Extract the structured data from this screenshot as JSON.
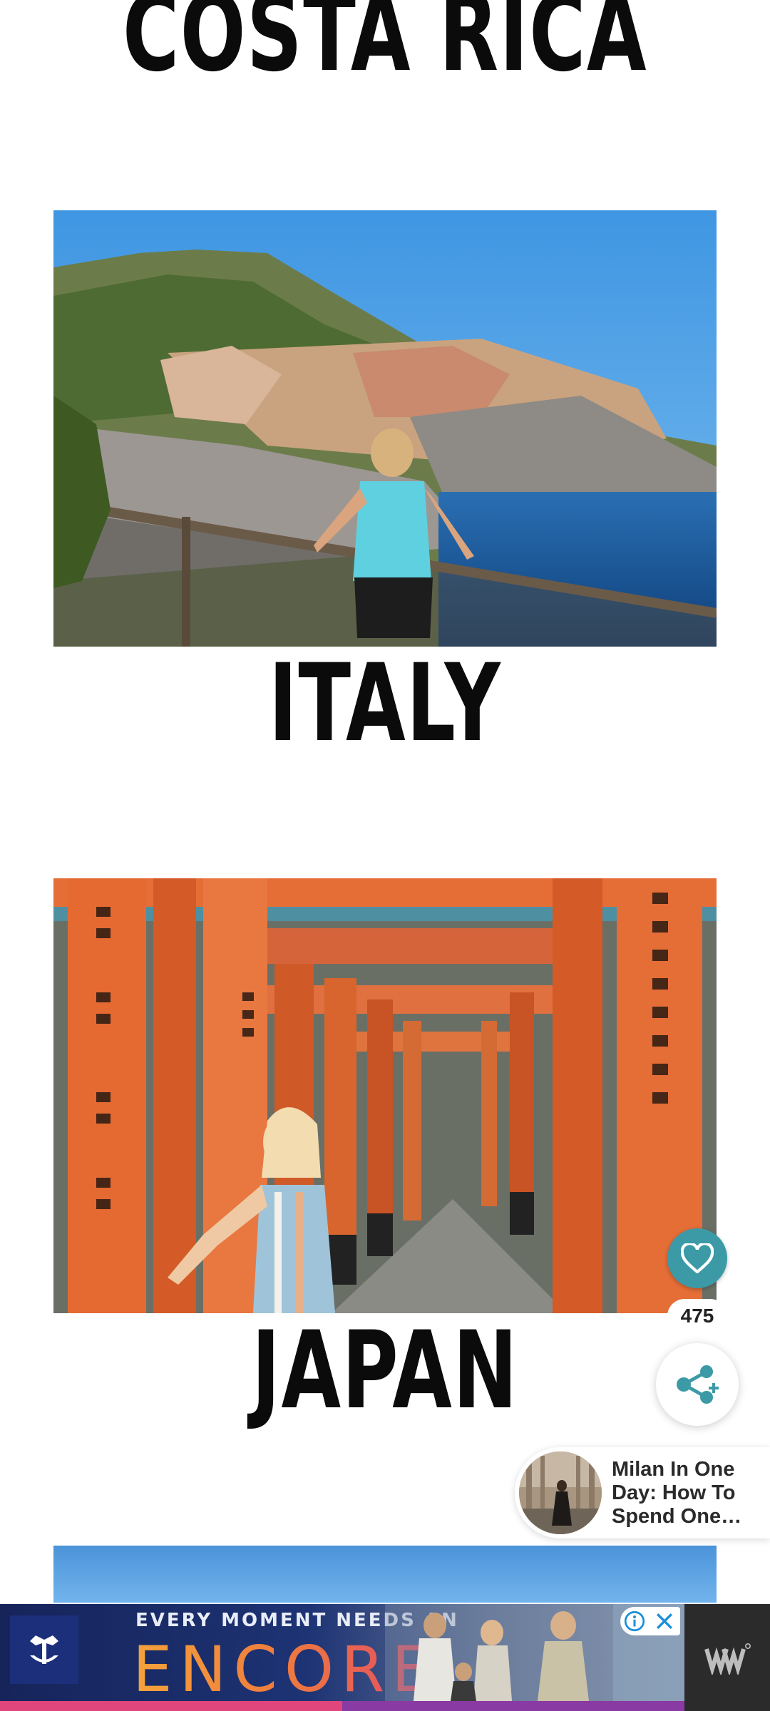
{
  "titles": {
    "costa_rica": "COSTA RICA",
    "italy": "ITALY",
    "japan": "JAPAN"
  },
  "photos": {
    "italy": "italy-cliff-village-photo",
    "japan": "japan-torii-gates-photo",
    "next": "sky-photo-partial"
  },
  "share_widget": {
    "like_icon": "heart-icon",
    "share_count": "475",
    "share_icon": "share-icon",
    "accent_color": "#3c9aa6"
  },
  "related_article": {
    "title": "Milan In One Day: How To Spend One…"
  },
  "ad": {
    "tagline": "EVERY MOMENT NEEDS AN",
    "headline": "ENCORE",
    "info_icon": "info-icon",
    "close_icon": "close-icon",
    "brand_icon": "crown-anchor-icon",
    "side_logo_icon": "wave-logo-icon"
  }
}
